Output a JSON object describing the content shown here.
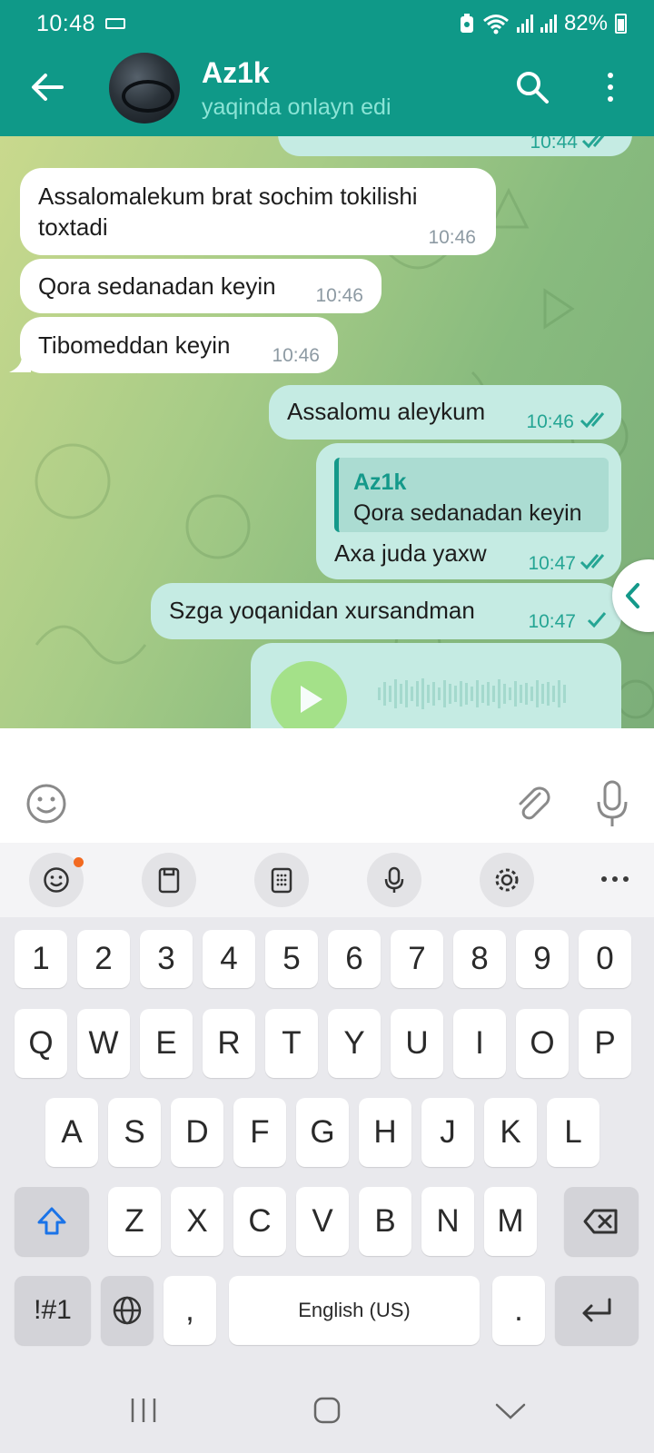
{
  "status_bar": {
    "time": "10:48",
    "battery": "82%"
  },
  "header": {
    "contact_name": "Az1k",
    "contact_status": "yaqinda onlayn edi"
  },
  "messages": [
    {
      "kind": "out",
      "text": "",
      "time": "10:44",
      "read": true,
      "partial": true
    },
    {
      "kind": "in",
      "text_lines": [
        "Assalomalekum brat sochim tokilishi",
        "toxtadi"
      ],
      "time": "10:46"
    },
    {
      "kind": "in",
      "text": "Qora sedanadan keyin",
      "time": "10:46"
    },
    {
      "kind": "in",
      "text": "Tibomeddan keyin",
      "time": "10:46"
    },
    {
      "kind": "out",
      "text": "Assalomu aleykum",
      "time": "10:46",
      "read": true
    },
    {
      "kind": "out",
      "reply_to_name": "Az1k",
      "reply_to_text": "Qora sedanadan keyin",
      "text": "Axa juda yaxw",
      "time": "10:47",
      "read": true
    },
    {
      "kind": "out",
      "text": "Szga yoqanidan xursandman",
      "time": "10:47",
      "read": false
    },
    {
      "kind": "out-voice",
      "partial": true
    }
  ],
  "input": {
    "placeholder": ""
  },
  "keyboard": {
    "number_row": [
      "1",
      "2",
      "3",
      "4",
      "5",
      "6",
      "7",
      "8",
      "9",
      "0"
    ],
    "row1": [
      "Q",
      "W",
      "E",
      "R",
      "T",
      "Y",
      "U",
      "I",
      "O",
      "P"
    ],
    "row2": [
      "A",
      "S",
      "D",
      "F",
      "G",
      "H",
      "J",
      "K",
      "L"
    ],
    "row3": [
      "Z",
      "X",
      "C",
      "V",
      "B",
      "N",
      "M"
    ],
    "symbols_key": "!#1",
    "comma_key": ",",
    "space_label": "English (US)",
    "period_key": "."
  }
}
